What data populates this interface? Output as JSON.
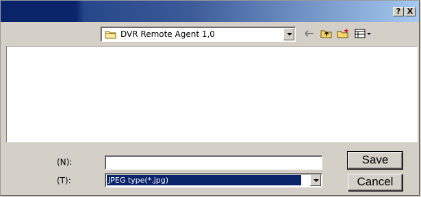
{
  "titlebar": {
    "help_label": "?",
    "close_label": "X"
  },
  "toolbar": {
    "location": "DVR Remote Agent 1,0",
    "icons": [
      "back-arrow-icon",
      "up-folder-icon",
      "new-folder-icon",
      "view-menu-icon"
    ]
  },
  "form": {
    "filename_label": "(N):",
    "filename_value": "",
    "filetype_label": "(T):",
    "filetype_value": "JPEG type(*.jpg)"
  },
  "buttons": {
    "save_label": "Save",
    "cancel_label": "Cancel"
  },
  "colors": {
    "title_dark": "#0a246a",
    "title_light": "#a6caf0",
    "face": "#d4d0c8",
    "selection": "#0a246a"
  }
}
